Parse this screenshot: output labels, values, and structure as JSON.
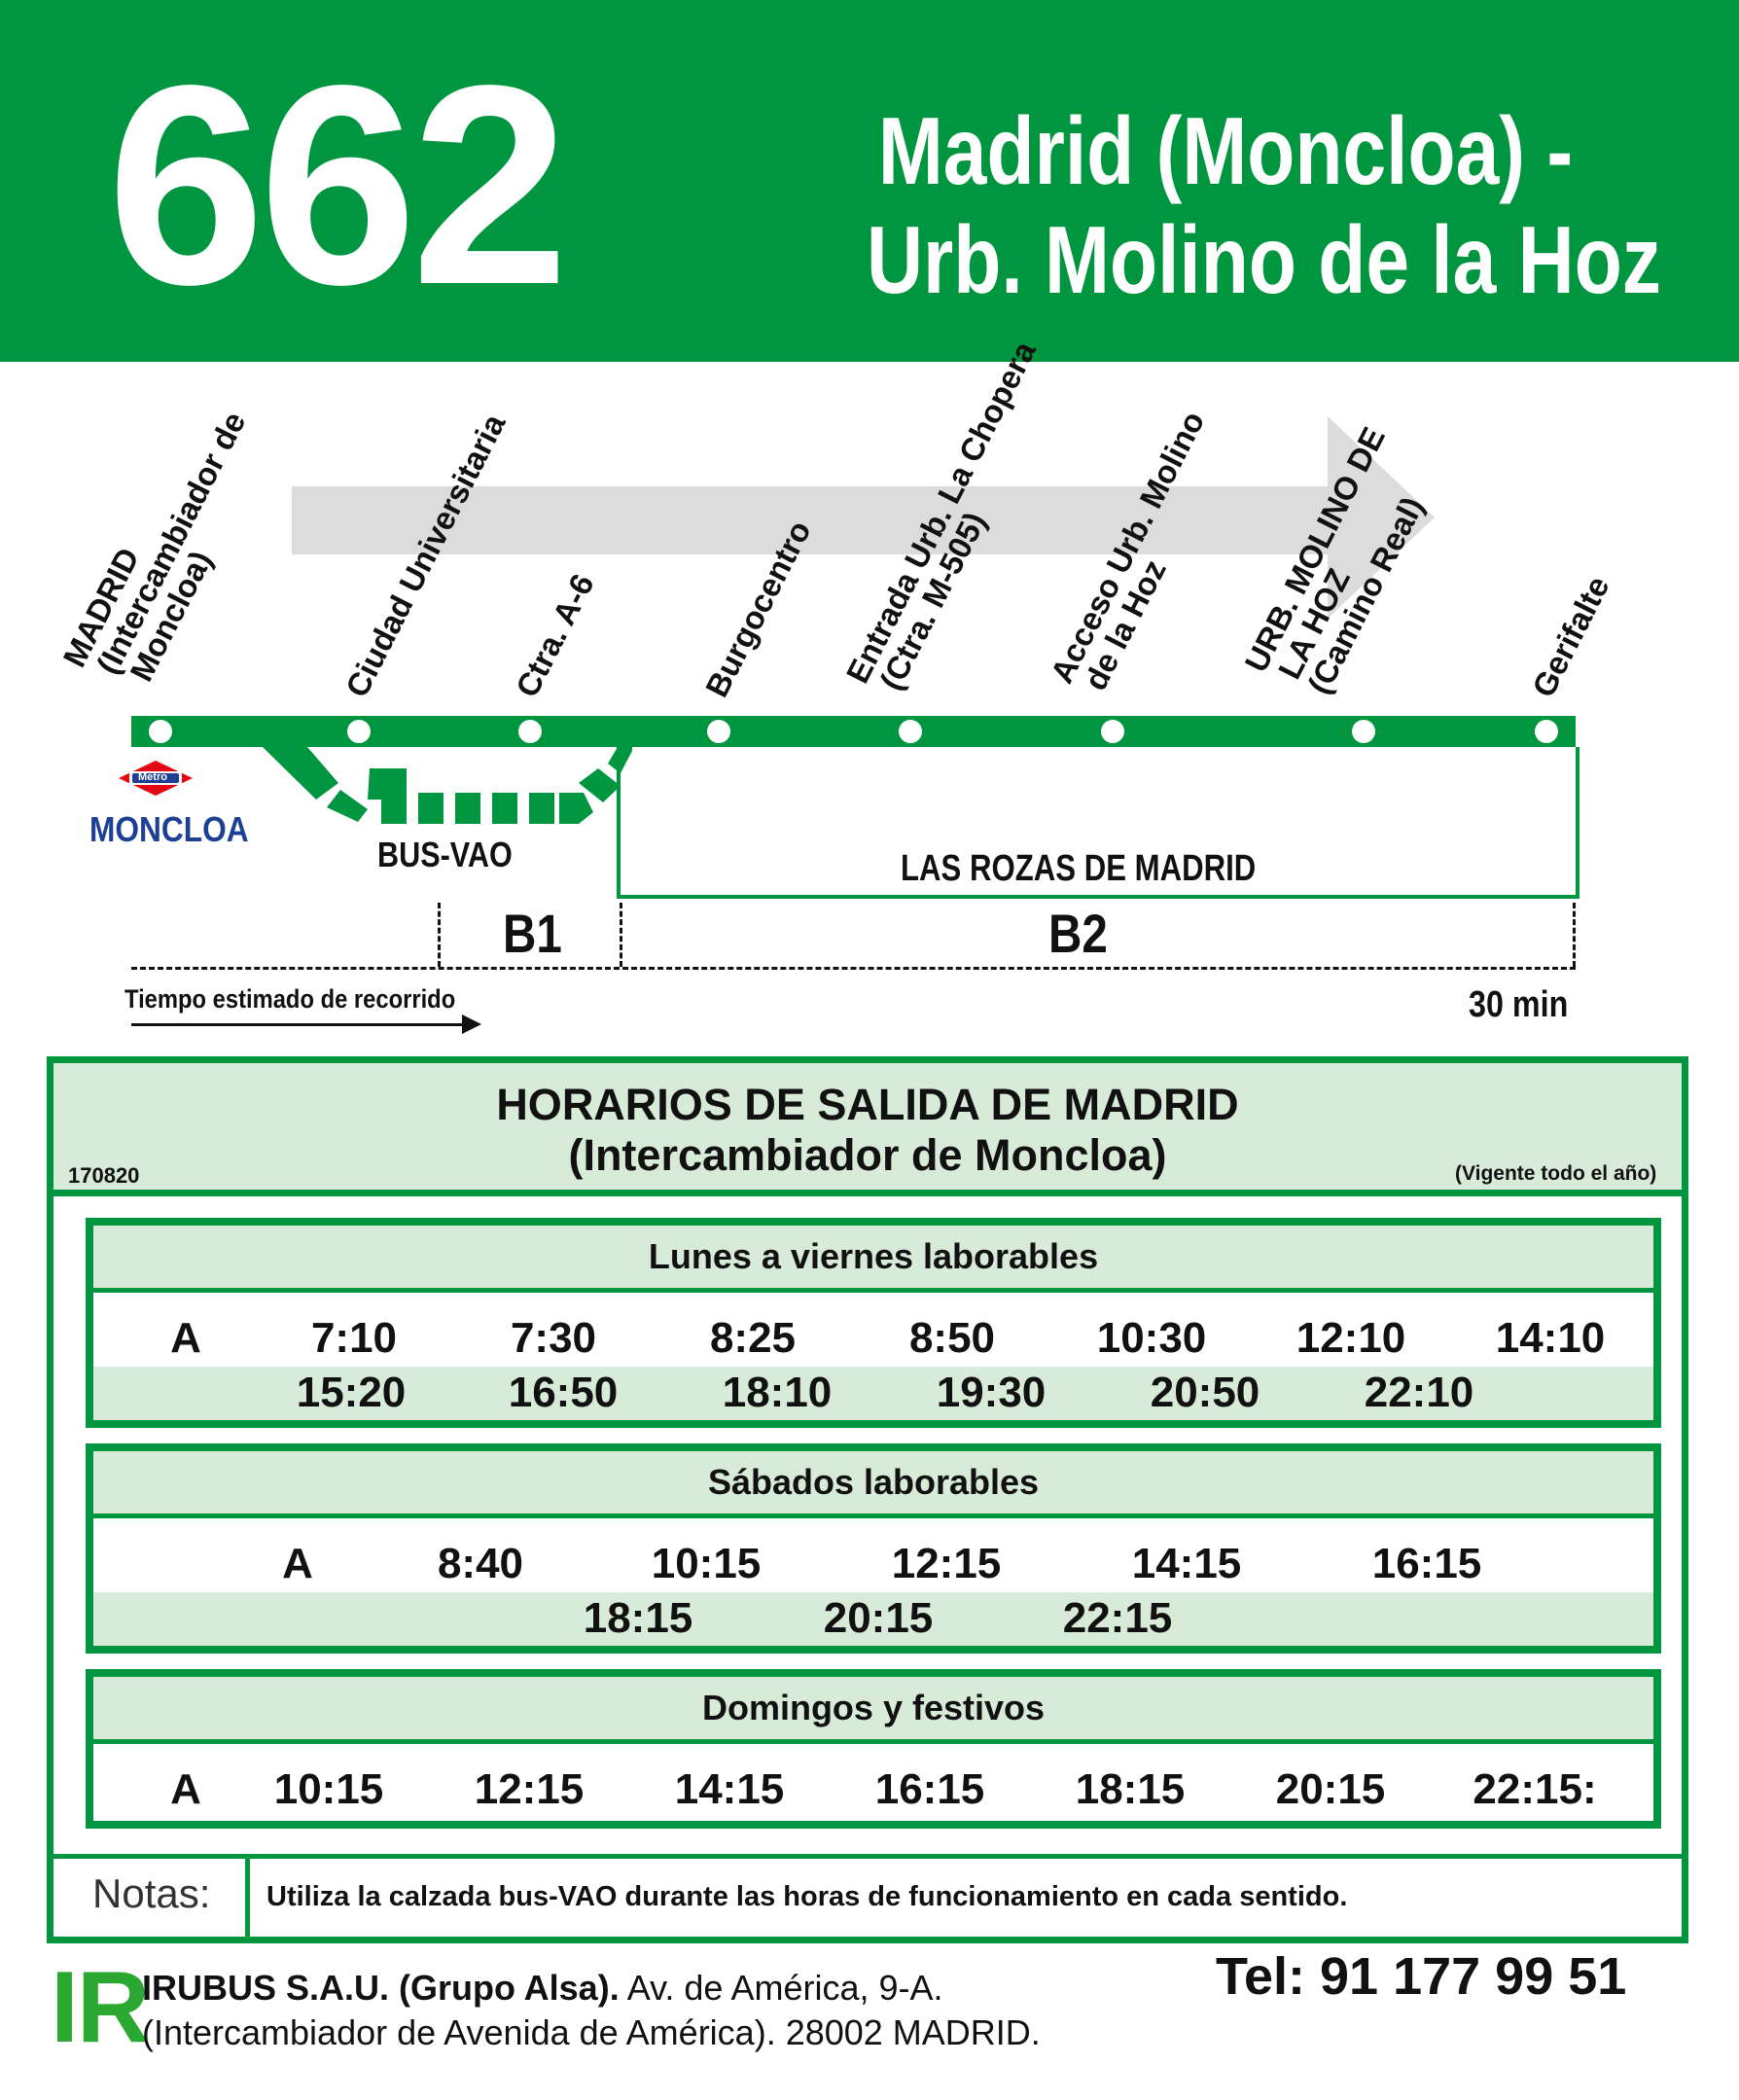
{
  "header": {
    "route_number": "662",
    "title_line1": "Madrid (Moncloa) -",
    "title_line2": "Urb. Molino de la Hoz"
  },
  "diagram": {
    "stops": [
      "MADRID\n (Intercambiador de\n  Moncloa)",
      "Ciudad Universitaria",
      "Ctra. A-6",
      "Burgocentro",
      "Entrada Urb. La Chopera\n (Ctra. M-505)",
      "Acceso Urb. Molino\n de la Hoz",
      "URB. MOLINO DE\n LA HOZ\n (Camino Real)",
      "Gerifalte"
    ],
    "metro_logo_text": "Metro",
    "metro_station": "MONCLOA",
    "bus_vao_label": "BUS-VAO",
    "zone_area_label": "LAS ROZAS DE MADRID",
    "zones": [
      "B1",
      "B2"
    ],
    "travel_time_label": "Tiempo estimado de recorrido",
    "travel_time": "30 min"
  },
  "timetable": {
    "title_line1": "HORARIOS DE SALIDA DE MADRID",
    "title_line2": "(Intercambiador de Moncloa)",
    "code": "170820",
    "validity": "(Vigente todo el año)",
    "weekdays": {
      "label": "Lunes a viernes laborables",
      "note_marker": "A",
      "row1": [
        "7:10",
        "7:30",
        "8:25",
        "8:50",
        "10:30",
        "12:10",
        "14:10"
      ],
      "row2": [
        "15:20",
        "16:50",
        "18:10",
        "19:30",
        "20:50",
        "22:10"
      ]
    },
    "saturdays": {
      "label": "Sábados laborables",
      "note_marker": "A",
      "row1": [
        "8:40",
        "10:15",
        "12:15",
        "14:15",
        "16:15"
      ],
      "row2": [
        "18:15",
        "20:15",
        "22:15"
      ]
    },
    "sundays": {
      "label": "Domingos y festivos",
      "note_marker": "A",
      "row1": [
        "10:15",
        "12:15",
        "14:15",
        "16:15",
        "18:15",
        "20:15",
        "22:15:"
      ]
    },
    "notes_label": "Notas:",
    "notes_text": "Utiliza la calzada bus-VAO durante las horas de funcionamiento en cada sentido."
  },
  "footer": {
    "logo": "IR",
    "company": "IRUBUS S.A.U. (Grupo Alsa).",
    "address1": " Av. de América, 9-A.",
    "address2": "(Intercambiador de Avenida de América). 28002 MADRID.",
    "phone": "Tel: 91 177 99 51"
  },
  "colors": {
    "brand_green": "#009640",
    "light_green": "#d8ebd8",
    "metro_red": "#e30613",
    "metro_blue": "#1d3f94",
    "logo_green": "#2aa832"
  }
}
